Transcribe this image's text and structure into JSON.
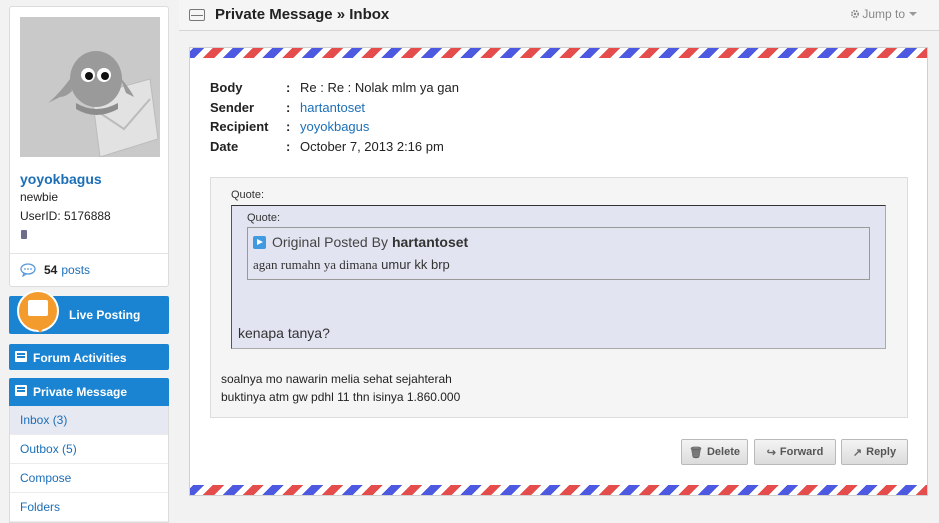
{
  "profile": {
    "username": "yoyokbagus",
    "rank": "newbie",
    "userid": "UserID: 5176888",
    "posts_count": "54",
    "posts_label": "posts"
  },
  "sidebar": {
    "live_posting": "Live Posting",
    "forum_activities": "Forum Activities",
    "private_message": "Private Message",
    "pm_items": [
      "Inbox (3)",
      "Outbox (5)",
      "Compose",
      "Folders"
    ]
  },
  "header": {
    "title": "Private Message » Inbox",
    "jump_to": "Jump to"
  },
  "message": {
    "labels": {
      "body": "Body",
      "sender": "Sender",
      "recipient": "Recipient",
      "date": "Date"
    },
    "colon": ":",
    "body": "Re : Re : Nolak mlm ya gan",
    "sender": "hartantoset",
    "recipient": "yoyokbagus",
    "date": "October 7, 2013 2:16 pm",
    "quote_label": "Quote:",
    "inner_quote_label": "Quote:",
    "original_posted_by": "Original Posted By",
    "original_author": "hartantoset",
    "original_text_serif": "agan rumahn ya dimana",
    "original_text_rest": " umur kk brp",
    "reply_in_quote": "kenapa tanya?",
    "line1": "soalnya mo nawarin melia sehat sejahterah",
    "line2": "buktinya atm gw pdhl 11 thn isinya 1.860.000"
  },
  "actions": {
    "delete": "Delete",
    "forward": "Forward",
    "reply": "Reply"
  },
  "colors": {
    "accent": "#1b84d2",
    "link": "#1c6fb7",
    "airmail_red": "#e54c4c",
    "airmail_blue": "#4c59e0"
  }
}
